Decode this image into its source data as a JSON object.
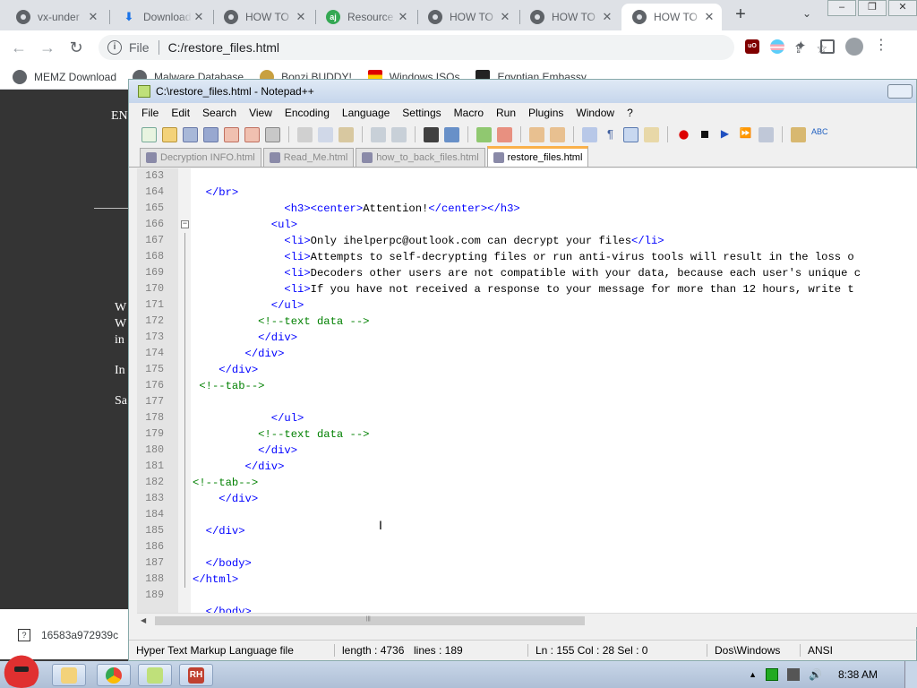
{
  "browser": {
    "tabs": [
      {
        "title": "vx-under",
        "icon": "globe-icon",
        "active": false
      },
      {
        "title": "Download",
        "icon": "download-icon",
        "active": false
      },
      {
        "title": "HOW TO",
        "icon": "globe-icon",
        "active": false
      },
      {
        "title": "Resource",
        "icon": "aj-icon",
        "active": false
      },
      {
        "title": "HOW TO",
        "icon": "globe-icon",
        "active": false
      },
      {
        "title": "HOW TO",
        "icon": "globe-icon",
        "active": false
      },
      {
        "title": "HOW TO",
        "icon": "globe-icon",
        "active": true
      }
    ],
    "omnibox": {
      "scheme_label": "File",
      "url": "C:/restore_files.html"
    },
    "bookmarks": [
      {
        "label": "MEMZ Download"
      },
      {
        "label": "Malware Database"
      },
      {
        "label": "Bonzi BUDDY!"
      },
      {
        "label": "Windows ISOs"
      },
      {
        "label": "Egyptian Embassy"
      }
    ],
    "background_page": {
      "en": "EN",
      "lines": [
        "W",
        "W",
        "in",
        "In",
        "Sa"
      ]
    },
    "download_item": "16583a972939c"
  },
  "notepad": {
    "title": "C:\\restore_files.html - Notepad++",
    "menu": [
      "File",
      "Edit",
      "Search",
      "View",
      "Encoding",
      "Language",
      "Settings",
      "Macro",
      "Run",
      "Plugins",
      "Window",
      "?"
    ],
    "file_tabs": [
      {
        "label": "Decryption INFO.html",
        "active": false
      },
      {
        "label": "Read_Me.html",
        "active": false
      },
      {
        "label": "how_to_back_files.html",
        "active": false
      },
      {
        "label": "restore_files.html",
        "active": true
      }
    ],
    "lines": [
      {
        "num": "163",
        "text": ""
      },
      {
        "num": "164",
        "text": "  </br>"
      },
      {
        "num": "165",
        "text": "              <h3><center>Attention!</center></h3>"
      },
      {
        "num": "166",
        "text": "            <ul>"
      },
      {
        "num": "167",
        "text": "              <li>Only ihelperpc@outlook.com can decrypt your files</li>"
      },
      {
        "num": "168",
        "text": "              <li>Attempts to self-decrypting files or run anti-virus tools will result in the loss o"
      },
      {
        "num": "169",
        "text": "              <li>Decoders other users are not compatible with your data, because each user's unique c"
      },
      {
        "num": "170",
        "text": "              <li>If you have not received a response to your message for more than 12 hours, write t"
      },
      {
        "num": "171",
        "text": "            </ul>"
      },
      {
        "num": "172",
        "text": "          <!--text data -->"
      },
      {
        "num": "173",
        "text": "          </div>"
      },
      {
        "num": "174",
        "text": "        </div>"
      },
      {
        "num": "175",
        "text": "    </div>"
      },
      {
        "num": "176",
        "text": " <!--tab-->"
      },
      {
        "num": "177",
        "text": ""
      },
      {
        "num": "178",
        "text": "            </ul>"
      },
      {
        "num": "179",
        "text": "          <!--text data -->"
      },
      {
        "num": "180",
        "text": "          </div>"
      },
      {
        "num": "181",
        "text": "        </div>"
      },
      {
        "num": "182",
        "text": "<!--tab-->"
      },
      {
        "num": "183",
        "text": "    </div>"
      },
      {
        "num": "184",
        "text": ""
      },
      {
        "num": "185",
        "text": "  </div>"
      },
      {
        "num": "186",
        "text": ""
      },
      {
        "num": "187",
        "text": "  </body>"
      },
      {
        "num": "188",
        "text": "</html>"
      },
      {
        "num": "189",
        "text": ""
      },
      {
        "num": "",
        "text": "  </body>"
      }
    ],
    "status": {
      "language": "Hyper Text Markup Language file",
      "length": "length : 4736",
      "lines": "lines : 189",
      "position": "Ln : 155    Col : 28    Sel : 0",
      "eol": "Dos\\Windows",
      "encoding": "ANSI"
    }
  },
  "taskbar": {
    "clock": "8:38 AM"
  },
  "colors": {
    "tag": "#0000ff",
    "comment": "#008000",
    "text": "#000000",
    "active_tab_accent": "#fab14b"
  }
}
